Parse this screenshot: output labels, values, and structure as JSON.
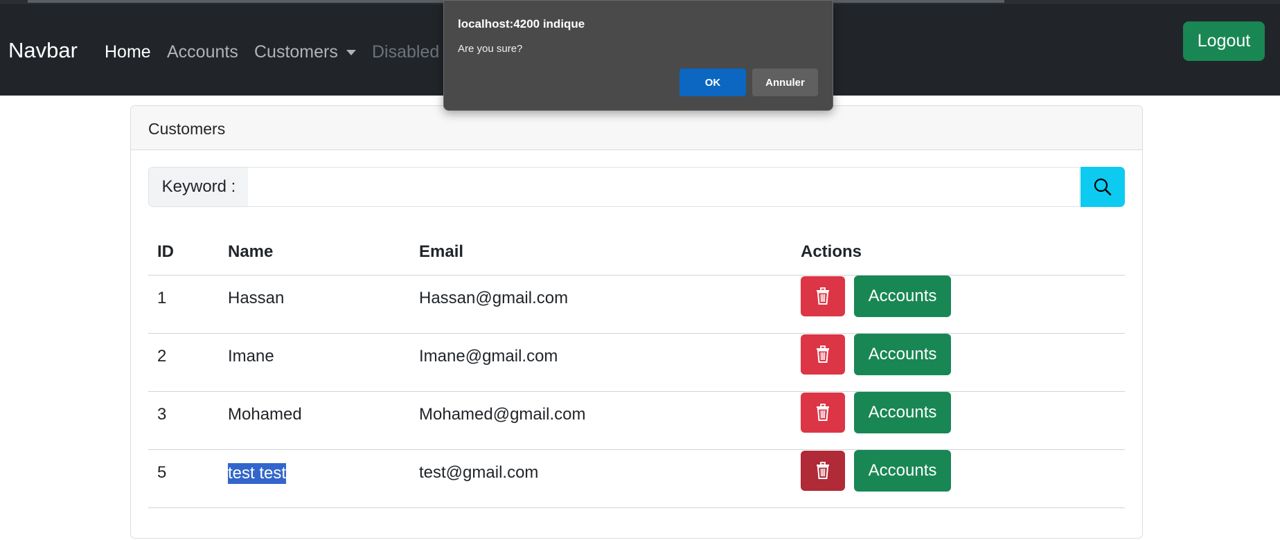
{
  "navbar": {
    "brand": "Navbar",
    "links": [
      {
        "label": "Home",
        "state": "active"
      },
      {
        "label": "Accounts",
        "state": "normal"
      },
      {
        "label": "Customers",
        "state": "dropdown"
      },
      {
        "label": "Disabled",
        "state": "disabled"
      }
    ],
    "logout_label": "Logout"
  },
  "card": {
    "title": "Customers",
    "search": {
      "label": "Keyword :",
      "value": "",
      "button_icon": "search-icon"
    },
    "table": {
      "headers": [
        "ID",
        "Name",
        "Email",
        "Actions"
      ],
      "rows": [
        {
          "id": "1",
          "name": "Hassan",
          "email": "Hassan@gmail.com"
        },
        {
          "id": "2",
          "name": "Imane",
          "email": "Imane@gmail.com"
        },
        {
          "id": "3",
          "name": "Mohamed",
          "email": "Mohamed@gmail.com"
        },
        {
          "id": "5",
          "name": "test test",
          "email": "test@gmail.com"
        }
      ],
      "delete_icon": "trash-icon",
      "accounts_label": "Accounts"
    }
  },
  "dialog": {
    "origin": "localhost:4200 indique",
    "message": "Are you sure?",
    "ok_label": "OK",
    "cancel_label": "Annuler"
  },
  "colors": {
    "navbar_bg": "#212529",
    "success": "#198754",
    "danger": "#dc3545",
    "info": "#0dcaf0",
    "dialog_bg": "#4a4a4a",
    "dialog_ok": "#0b67c2"
  }
}
